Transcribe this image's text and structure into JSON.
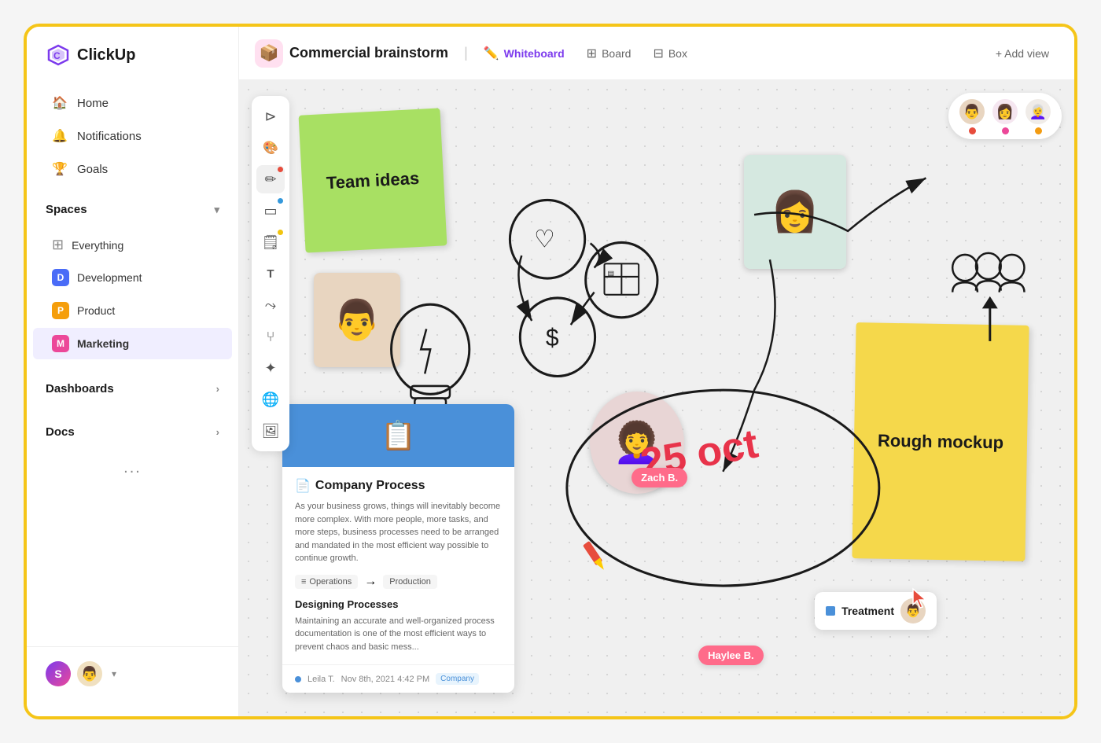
{
  "app": {
    "name": "ClickUp"
  },
  "sidebar": {
    "nav": [
      {
        "id": "home",
        "label": "Home",
        "icon": "🏠"
      },
      {
        "id": "notifications",
        "label": "Notifications",
        "icon": "🔔"
      },
      {
        "id": "goals",
        "label": "Goals",
        "icon": "🏆"
      }
    ],
    "spaces_label": "Spaces",
    "spaces": [
      {
        "id": "everything",
        "label": "Everything",
        "color": null,
        "initial": null
      },
      {
        "id": "development",
        "label": "Development",
        "color": "#4a6cf7",
        "initial": "D"
      },
      {
        "id": "product",
        "label": "Product",
        "color": "#f59e0b",
        "initial": "P"
      },
      {
        "id": "marketing",
        "label": "Marketing",
        "color": "#ec4899",
        "initial": "M",
        "bold": true
      }
    ],
    "dashboards_label": "Dashboards",
    "docs_label": "Docs",
    "more_label": "..."
  },
  "topbar": {
    "project_title": "Commercial brainstorm",
    "views": [
      {
        "id": "whiteboard",
        "label": "Whiteboard",
        "active": true,
        "icon": "✏️"
      },
      {
        "id": "board",
        "label": "Board",
        "active": false,
        "icon": "⊞"
      },
      {
        "id": "box",
        "label": "Box",
        "active": false,
        "icon": "⊟"
      }
    ],
    "add_view_label": "+ Add view"
  },
  "toolbar": {
    "tools": [
      {
        "id": "cursor",
        "icon": "⊳",
        "dot": null
      },
      {
        "id": "colorpicker",
        "icon": "🎨",
        "dot": null
      },
      {
        "id": "pencil",
        "icon": "✏",
        "dot": "#e74c3c"
      },
      {
        "id": "rect",
        "icon": "▭",
        "dot": "#3498db"
      },
      {
        "id": "note",
        "icon": "🗒",
        "dot": "#f1c40f"
      },
      {
        "id": "text",
        "icon": "T",
        "dot": null
      },
      {
        "id": "connector",
        "icon": "⤳",
        "dot": null
      },
      {
        "id": "share",
        "icon": "⑂",
        "dot": null
      },
      {
        "id": "ai",
        "icon": "✦",
        "dot": null
      },
      {
        "id": "globe",
        "icon": "🌐",
        "dot": null
      },
      {
        "id": "image",
        "icon": "🖼",
        "dot": null
      }
    ]
  },
  "canvas": {
    "sticky_green": {
      "text": "Team ideas"
    },
    "sticky_yellow": {
      "text": "Rough mockup"
    },
    "doc_card": {
      "title": "Company Process",
      "body": "As your business grows, things will inevitably become more complex. With more people, more tasks, and more steps, business processes need to be arranged and mandated in the most efficient way possible to continue growth.",
      "tag1": "Operations",
      "tag2": "Production",
      "section": "Designing Processes",
      "section_text": "Maintaining an accurate and well-organized process documentation is one of the most efficient ways to prevent chaos and basic mess...",
      "footer_author": "Leila T.",
      "footer_date": "Nov 8th, 2021  4:42 PM",
      "footer_tag": "Company"
    },
    "names": [
      {
        "id": "zach",
        "label": "Zach B."
      },
      {
        "id": "haylee",
        "label": "Haylee B."
      }
    ],
    "treatment": {
      "label": "Treatment"
    },
    "date": "25 oct",
    "collab_avatars": [
      {
        "id": "av1",
        "emoji": "👨"
      },
      {
        "id": "av2",
        "emoji": "👩"
      },
      {
        "id": "av3",
        "emoji": "👩‍🦳"
      }
    ],
    "collab_dots": [
      "#e74c3c",
      "#ec4899",
      "#f39c12"
    ]
  }
}
